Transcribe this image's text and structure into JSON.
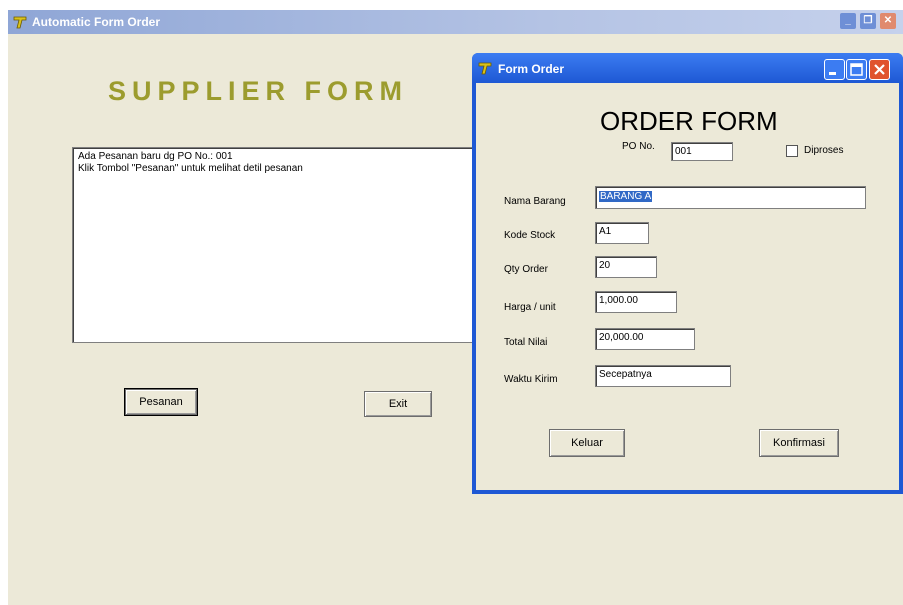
{
  "main_window": {
    "title": "Automatic Form Order",
    "heading": "SUPPLIER FORM",
    "memo_lines": [
      "Ada Pesanan baru dg PO No.: 001",
      "Klik Tombol \"Pesanan\" untuk melihat detil pesanan"
    ],
    "pesanan_button": "Pesanan",
    "exit_button": "Exit"
  },
  "order_dialog": {
    "title": "Form Order",
    "heading": "ORDER FORM",
    "po_label": "PO No.",
    "po_value": "001",
    "diproses_label": "Diproses",
    "fields": {
      "nama_barang": {
        "label": "Nama Barang",
        "value": "BARANG A"
      },
      "kode_stock": {
        "label": "Kode Stock",
        "value": "A1"
      },
      "qty_order": {
        "label": "Qty Order",
        "value": "20"
      },
      "harga_unit": {
        "label": "Harga / unit",
        "value": "1,000.00"
      },
      "total_nilai": {
        "label": "Total Nilai",
        "value": "20,000.00"
      },
      "waktu_kirim": {
        "label": "Waktu Kirim",
        "value": "Secepatnya"
      }
    },
    "keluar_button": "Keluar",
    "konfirmasi_button": "Konfirmasi"
  },
  "colors": {
    "supplier_heading": "#9c9c2e",
    "dialog_frame": "#1e58d4",
    "selection": "#3169c6"
  }
}
